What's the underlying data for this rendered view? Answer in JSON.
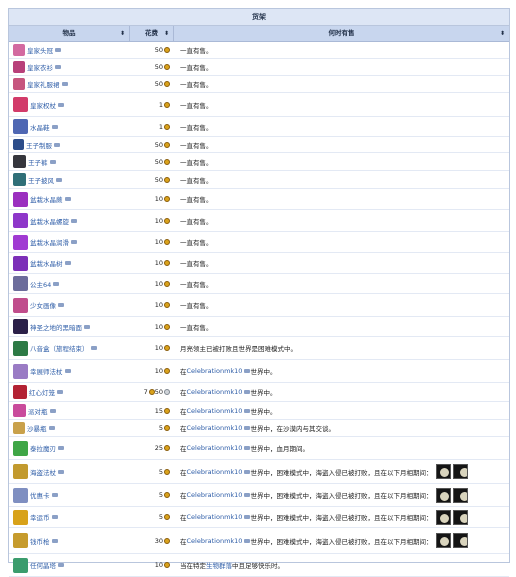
{
  "table": {
    "caption": "货架",
    "headers": {
      "item": "物品",
      "price": "花费",
      "when": "何时有售"
    },
    "sort_glyph": "⬍",
    "rows": [
      {
        "name": "皇家头冠",
        "price": "50",
        "coin": "gold",
        "when_text": "一直有售。",
        "icon_color": "#d36aa0"
      },
      {
        "name": "皇家衣衫",
        "price": "50",
        "coin": "gold",
        "when_text": "一直有售。",
        "icon_color": "#b8407a"
      },
      {
        "name": "皇家礼服裙",
        "price": "50",
        "coin": "gold",
        "when_text": "一直有售。",
        "icon_color": "#c6557e"
      },
      {
        "name": "皇家权杖",
        "price": "1",
        "coin": "gold",
        "when_text": "一直有售。",
        "icon_color": "#d23b6a"
      },
      {
        "name": "水晶鞋",
        "price": "1",
        "coin": "gold",
        "when_text": "一直有售。",
        "icon_color": "#4f67b3"
      },
      {
        "name": "王子制服",
        "price": "50",
        "coin": "gold",
        "when_text": "一直有售。",
        "icon_color": "#2c4d8a"
      },
      {
        "name": "王子裤",
        "price": "50",
        "coin": "gold",
        "when_text": "一直有售。",
        "icon_color": "#35363d"
      },
      {
        "name": "王子披风",
        "price": "50",
        "coin": "gold",
        "when_text": "一直有售。",
        "icon_color": "#2f6f78"
      },
      {
        "name": "盆栽水晶蕨",
        "price": "10",
        "coin": "gold",
        "when_text": "一直有售。",
        "icon_color": "#9b2fbf"
      },
      {
        "name": "盆栽水晶螺旋",
        "price": "10",
        "coin": "gold",
        "when_text": "一直有售。",
        "icon_color": "#8e36c9"
      },
      {
        "name": "盆栽水晶润滑",
        "price": "10",
        "coin": "gold",
        "when_text": "一直有售。",
        "icon_color": "#a03ad2"
      },
      {
        "name": "盆栽水晶树",
        "price": "10",
        "coin": "gold",
        "when_text": "一直有售。",
        "icon_color": "#7c2fb8"
      },
      {
        "name": "公主64",
        "price": "10",
        "coin": "gold",
        "when_text": "一直有售。",
        "icon_color": "#6c6c9b"
      },
      {
        "name": "少女画像",
        "price": "10",
        "coin": "gold",
        "when_text": "一直有售。",
        "icon_color": "#c04d8c"
      },
      {
        "name": "神圣之地的黑暗面",
        "price": "10",
        "coin": "gold",
        "when_text": "一直有售。",
        "icon_color": "#2b2048"
      },
      {
        "name": "八音盒（旅程结束）",
        "price": "10",
        "coin": "gold",
        "when_text": "月亮领主已被打败且世界是困难模式中。",
        "icon_color": "#2d7a45"
      },
      {
        "name": "幸展师法杖",
        "price": "10",
        "coin": "gold",
        "when_pre": "在",
        "when_link": "Celebrationmk10",
        "when_post": "世界中。",
        "icon_color": "#9a7bc4"
      },
      {
        "name": "红心灯笼",
        "price": "7",
        "price2": "50",
        "coin": "gold",
        "coin2": "silver",
        "when_pre": "在",
        "when_link": "Celebrationmk10",
        "when_post": "世界中。",
        "icon_color": "#b32234"
      },
      {
        "name": "派对瓶",
        "price": "15",
        "coin": "gold",
        "when_pre": "在",
        "when_link": "Celebrationmk10",
        "when_post": "世界中。",
        "icon_color": "#c94b9c"
      },
      {
        "name": "沙暴瓶",
        "price": "5",
        "coin": "gold",
        "when_pre": "在",
        "when_link": "Celebrationmk10",
        "when_post": "世界中，在沙漠内与其交谈。",
        "icon_color": "#c9a14b"
      },
      {
        "name": "泰拉魔刃",
        "price": "25",
        "coin": "gold",
        "when_pre": "在",
        "when_link": "Celebrationmk10",
        "when_post": "世界中，血月期间。",
        "icon_color": "#3fa646"
      },
      {
        "name": "海盗法杖",
        "price": "5",
        "coin": "gold",
        "when_pre": "在",
        "when_link": "Celebrationmk10",
        "when_post": "世界中，困难模式中，海盗入侵已被打败，且在以下月相期间：",
        "moons": 2,
        "icon_color": "#c29a2e"
      },
      {
        "name": "优惠卡",
        "price": "5",
        "coin": "gold",
        "when_pre": "在",
        "when_link": "Celebrationmk10",
        "when_post": "世界中，困难模式中，海盗入侵已被打败，且在以下月相期间：",
        "moons": 2,
        "icon_color": "#7f8fc1"
      },
      {
        "name": "幸运币",
        "price": "5",
        "coin": "gold",
        "when_pre": "在",
        "when_link": "Celebrationmk10",
        "when_post": "世界中，困难模式中，海盗入侵已被打败，且在以下月相期间：",
        "moons": 2,
        "icon_color": "#d8a21a"
      },
      {
        "name": "钱币枪",
        "price": "30",
        "coin": "gold",
        "when_pre": "在",
        "when_link": "Celebrationmk10",
        "when_post": "世界中，困难模式中，海盗入侵已被打败，且在以下月相期间：",
        "moons": 2,
        "icon_color": "#c69b2c"
      },
      {
        "name": "任何晶塔",
        "price": "10",
        "coin": "gold",
        "when_pre": "当在特定",
        "when_link": "生物群落",
        "when_post": "中且足够快乐时。",
        "icon_color": "#3b9c6d"
      }
    ]
  }
}
